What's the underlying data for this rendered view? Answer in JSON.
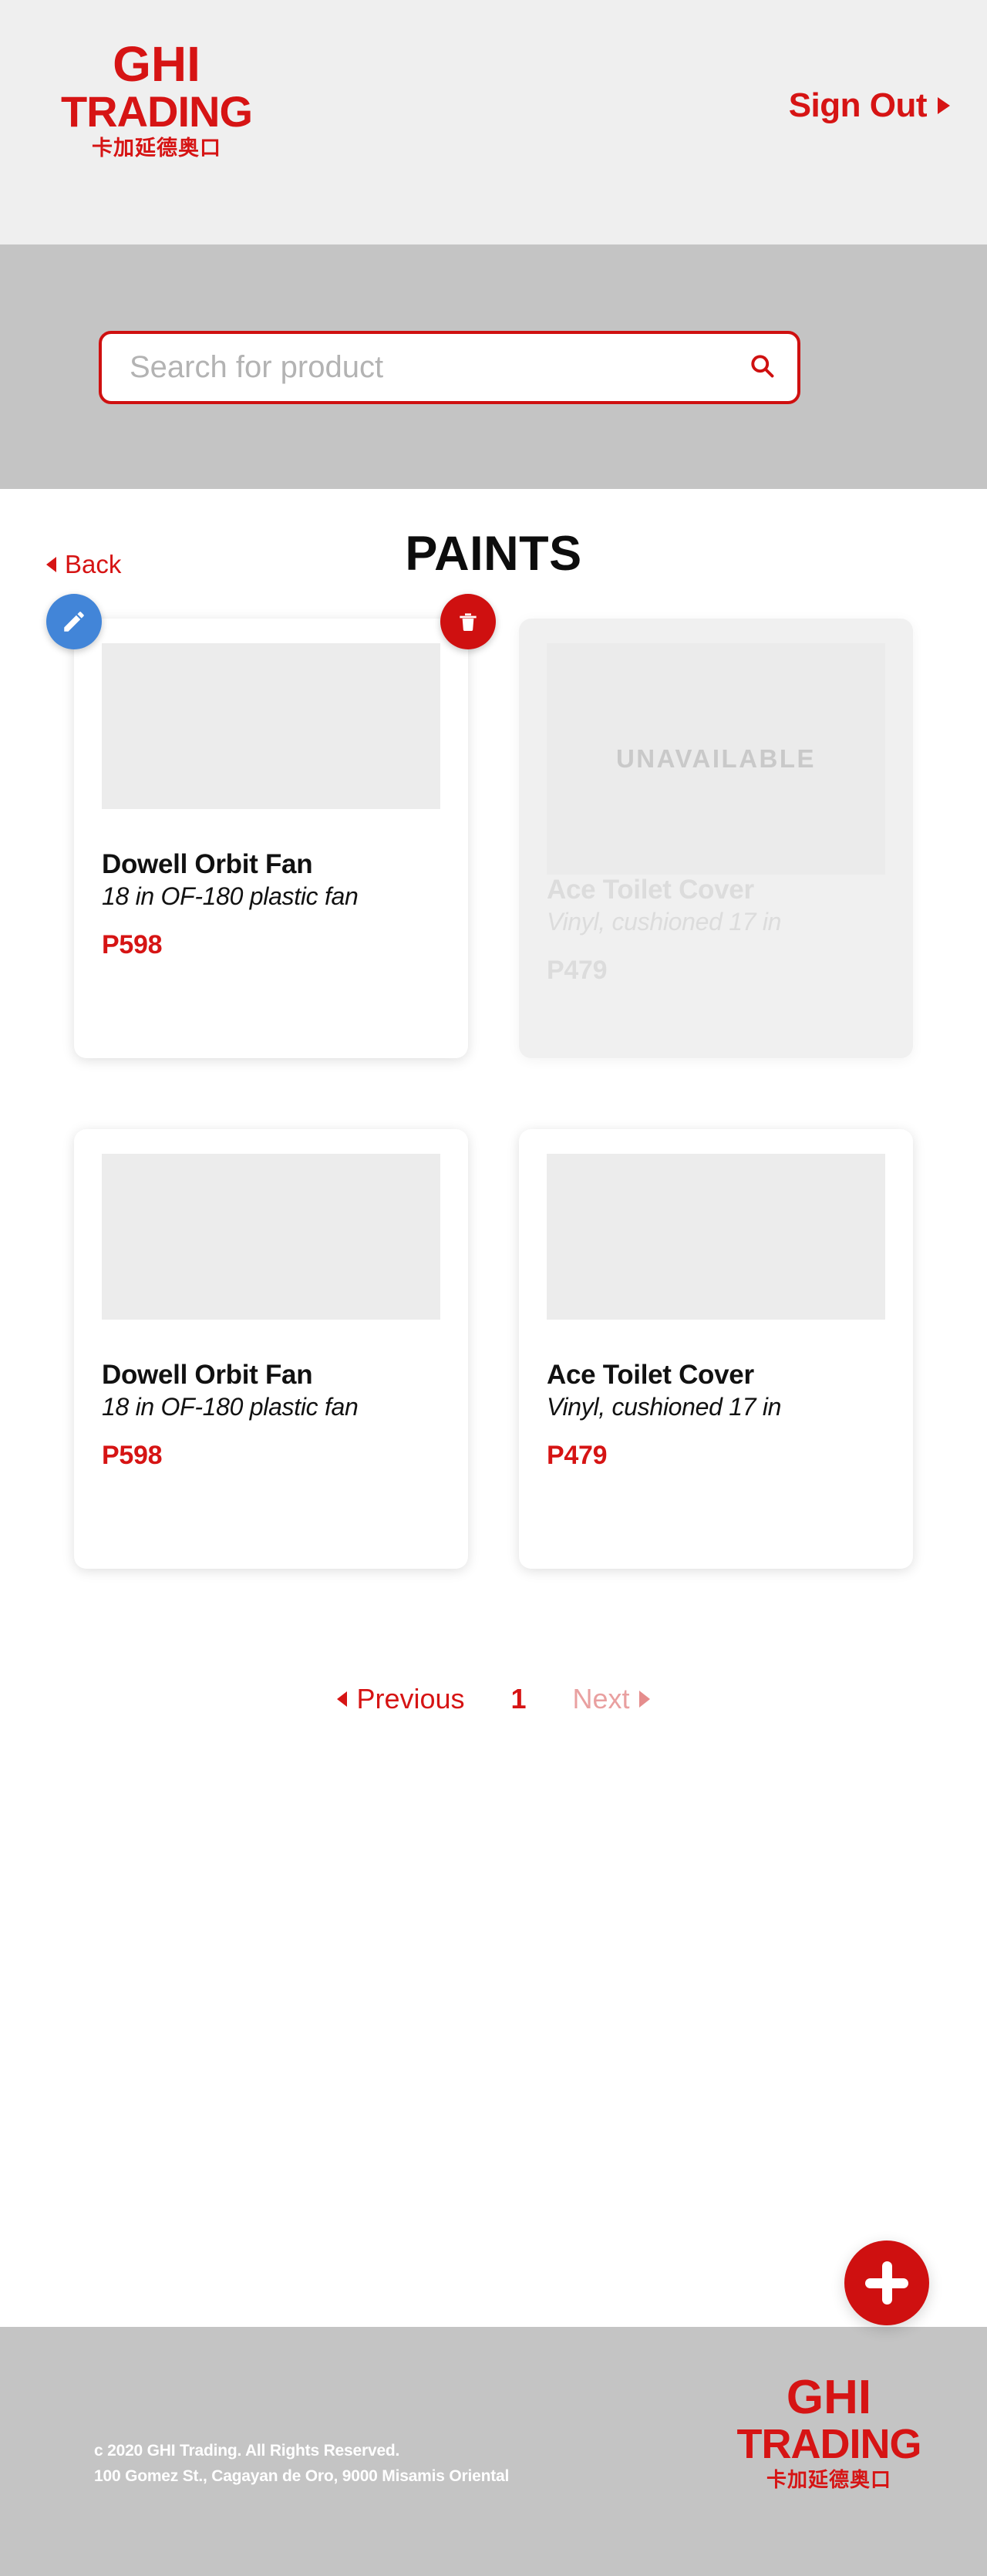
{
  "header": {
    "brand_line1": "GHI",
    "brand_line2": "TRADING",
    "brand_cn": "卡加延德奥口",
    "signout_label": "Sign Out"
  },
  "search": {
    "placeholder": "Search for product",
    "value": "",
    "icon": "search-icon"
  },
  "main": {
    "back_label": "Back",
    "title": "PAINTS"
  },
  "products": [
    {
      "title": "Dowell Orbit Fan",
      "description": "18 in OF-180 plastic fan",
      "price": "P598",
      "available": true,
      "selected": true,
      "edit_icon": "pencil-icon",
      "delete_icon": "trash-icon"
    },
    {
      "title": "Ace Toilet Cover",
      "description": "Vinyl, cushioned 17 in",
      "price": "P479",
      "available": false,
      "unavailable_label": "UNAVAILABLE",
      "selected": false
    },
    {
      "title": "Dowell Orbit Fan",
      "description": "18 in OF-180 plastic fan",
      "price": "P598",
      "available": true,
      "selected": false
    },
    {
      "title": "Ace Toilet Cover",
      "description": "Vinyl, cushioned 17 in",
      "price": "P479",
      "available": true,
      "selected": false
    }
  ],
  "pagination": {
    "previous_label": "Previous",
    "current_page": "1",
    "next_label": "Next"
  },
  "add_button": {
    "icon": "plus-icon"
  },
  "footer": {
    "copyright": "c 2020 GHI Trading. All Rights Reserved.",
    "address": "100 Gomez St., Cagayan de Oro, 9000 Misamis Oriental",
    "brand_line1": "GHI",
    "brand_line2": "TRADING",
    "brand_cn": "卡加延德奥口"
  },
  "colors": {
    "brand_red": "#d61414",
    "accent_red": "#cf1010",
    "edit_blue": "#4285d8",
    "band_gray": "#c4c4c4",
    "header_gray": "#efefef"
  }
}
